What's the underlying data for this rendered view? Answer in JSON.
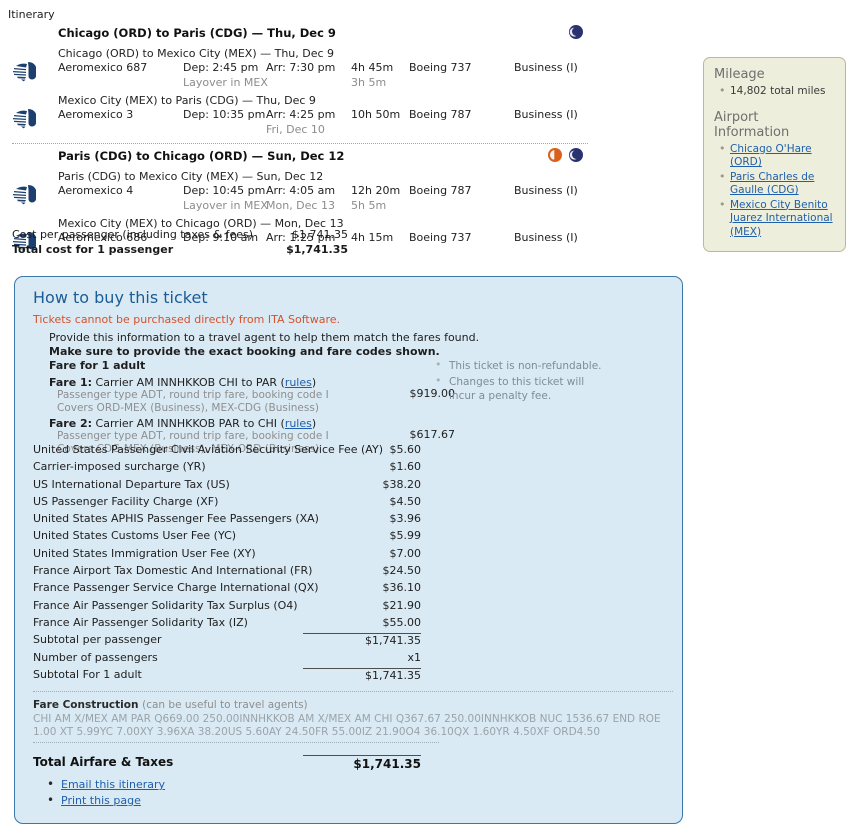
{
  "itinerary_label": "Itinerary",
  "legs": [
    {
      "title": "Chicago (ORD) to Paris (CDG) — Thu, Dec 9",
      "indicators": [
        "night"
      ],
      "flights": [
        {
          "route": "Chicago (ORD) to Mexico City (MEX) — Thu, Dec 9",
          "airline": "Aeromexico 687",
          "dep": "Dep: 2:45 pm",
          "arr": "Arr: 7:30 pm",
          "duration": "4h 45m",
          "aircraft": "Boeing 737",
          "cabin": "Business (I)",
          "layover": "Layover in MEX",
          "arr_note": "",
          "layover_duration": "3h 5m"
        },
        {
          "route": "Mexico City (MEX) to Paris (CDG) — Thu, Dec 9",
          "airline": "Aeromexico 3",
          "dep": "Dep: 10:35 pm",
          "arr": "Arr: 4:25 pm",
          "duration": "10h 50m",
          "aircraft": "Boeing 787",
          "cabin": "Business (I)",
          "layover": "",
          "arr_note": "Fri, Dec 10",
          "layover_duration": ""
        }
      ]
    },
    {
      "title": "Paris (CDG) to Chicago (ORD) — Sun, Dec 12",
      "indicators": [
        "day",
        "night"
      ],
      "flights": [
        {
          "route": "Paris (CDG) to Mexico City (MEX) — Sun, Dec 12",
          "airline": "Aeromexico 4",
          "dep": "Dep: 10:45 pm",
          "arr": "Arr: 4:05 am",
          "duration": "12h 20m",
          "aircraft": "Boeing 787",
          "cabin": "Business (I)",
          "layover": "Layover in MEX",
          "arr_note": "Mon, Dec 13",
          "layover_duration": "5h 5m"
        },
        {
          "route": "Mexico City (MEX) to Chicago (ORD) — Mon, Dec 13",
          "airline": "Aeromexico 686",
          "dep": "Dep: 9:10 am",
          "arr": "Arr: 1:25 pm",
          "duration": "4h 15m",
          "aircraft": "Boeing 737",
          "cabin": "Business (I)",
          "layover": "",
          "arr_note": "",
          "layover_duration": ""
        }
      ]
    }
  ],
  "cost_summary": [
    {
      "label": "Cost per passenger (including taxes & fees)",
      "value": "$1,741.35",
      "bold": false
    },
    {
      "label": "Total cost for 1 passenger",
      "value": "$1,741.35",
      "bold": true
    }
  ],
  "sidebar": {
    "mileage_heading": "Mileage",
    "mileage_items": [
      "14,802 total miles"
    ],
    "airport_heading": "Airport Information",
    "airports": [
      "Chicago O'Hare (ORD)",
      "Paris Charles de Gaulle (CDG)",
      "Mexico City Benito Juarez International (MEX)"
    ]
  },
  "buy": {
    "heading": "How to buy this ticket",
    "warning": "Tickets cannot be purchased directly from ITA Software.",
    "line1": "Provide this information to a travel agent to help them match the fares found.",
    "line2": "Make sure to provide the exact booking and fare codes shown.",
    "line3": "Fare for 1 adult",
    "rules_label": "rules",
    "fares": [
      {
        "prefix": "Fare 1:",
        "title": " Carrier AM INNHKKOB CHI to PAR (",
        "suffix": ")",
        "detail": "Passenger type ADT, round trip fare, booking code I",
        "covers": "Covers ORD-MEX (Business), MEX-CDG (Business)",
        "price": "$919.00"
      },
      {
        "prefix": "Fare 2:",
        "title": " Carrier AM INNHKKOB PAR to CHI (",
        "suffix": ")",
        "detail": "Passenger type ADT, round trip fare, booking code I",
        "covers": "Covers CDG-MEX (Business), MEX-ORD (Business)",
        "price": "$617.67"
      }
    ],
    "notes": [
      "This ticket is non-refundable.",
      "Changes to this ticket will incur a penalty fee."
    ],
    "taxes": [
      {
        "label": "United States Passenger Civil Aviation Security Service Fee (AY)",
        "value": "$5.60",
        "rule": false
      },
      {
        "label": "Carrier-imposed surcharge (YR)",
        "value": "$1.60",
        "rule": false
      },
      {
        "label": "US International Departure Tax (US)",
        "value": "$38.20",
        "rule": false
      },
      {
        "label": "US Passenger Facility Charge (XF)",
        "value": "$4.50",
        "rule": false
      },
      {
        "label": "United States APHIS Passenger Fee Passengers (XA)",
        "value": "$3.96",
        "rule": false
      },
      {
        "label": "United States Customs User Fee (YC)",
        "value": "$5.99",
        "rule": false
      },
      {
        "label": "United States Immigration User Fee (XY)",
        "value": "$7.00",
        "rule": false
      },
      {
        "label": "France Airport Tax Domestic And International (FR)",
        "value": "$24.50",
        "rule": false
      },
      {
        "label": "France Passenger Service Charge International (QX)",
        "value": "$36.10",
        "rule": false
      },
      {
        "label": "France Air Passenger Solidarity Tax Surplus (O4)",
        "value": "$21.90",
        "rule": false
      },
      {
        "label": "France Air Passenger Solidarity Tax (IZ)",
        "value": "$55.00",
        "rule": false
      },
      {
        "label": "Subtotal per passenger",
        "value": "$1,741.35",
        "rule": true
      },
      {
        "label": "Number of passengers",
        "value": "x1",
        "rule": false
      },
      {
        "label": "Subtotal For 1 adult",
        "value": "$1,741.35",
        "rule": true
      }
    ],
    "fare_construction_heading": "Fare Construction",
    "fare_construction_note": "(can be useful to travel agents)",
    "fare_construction_body": "CHI AM X/MEX AM PAR Q669.00 250.00INNHKKOB AM X/MEX AM CHI Q367.67 250.00INNHKKOB NUC 1536.67 END ROE 1.00 XT 5.99YC 7.00XY 3.96XA 38.20US 5.60AY 24.50FR 55.00IZ 21.90O4 36.10QX 1.60YR 4.50XF ORD4.50",
    "total_label": "Total Airfare & Taxes",
    "total_value": "$1,741.35",
    "links": [
      "Email this itinerary",
      "Print this page"
    ]
  }
}
